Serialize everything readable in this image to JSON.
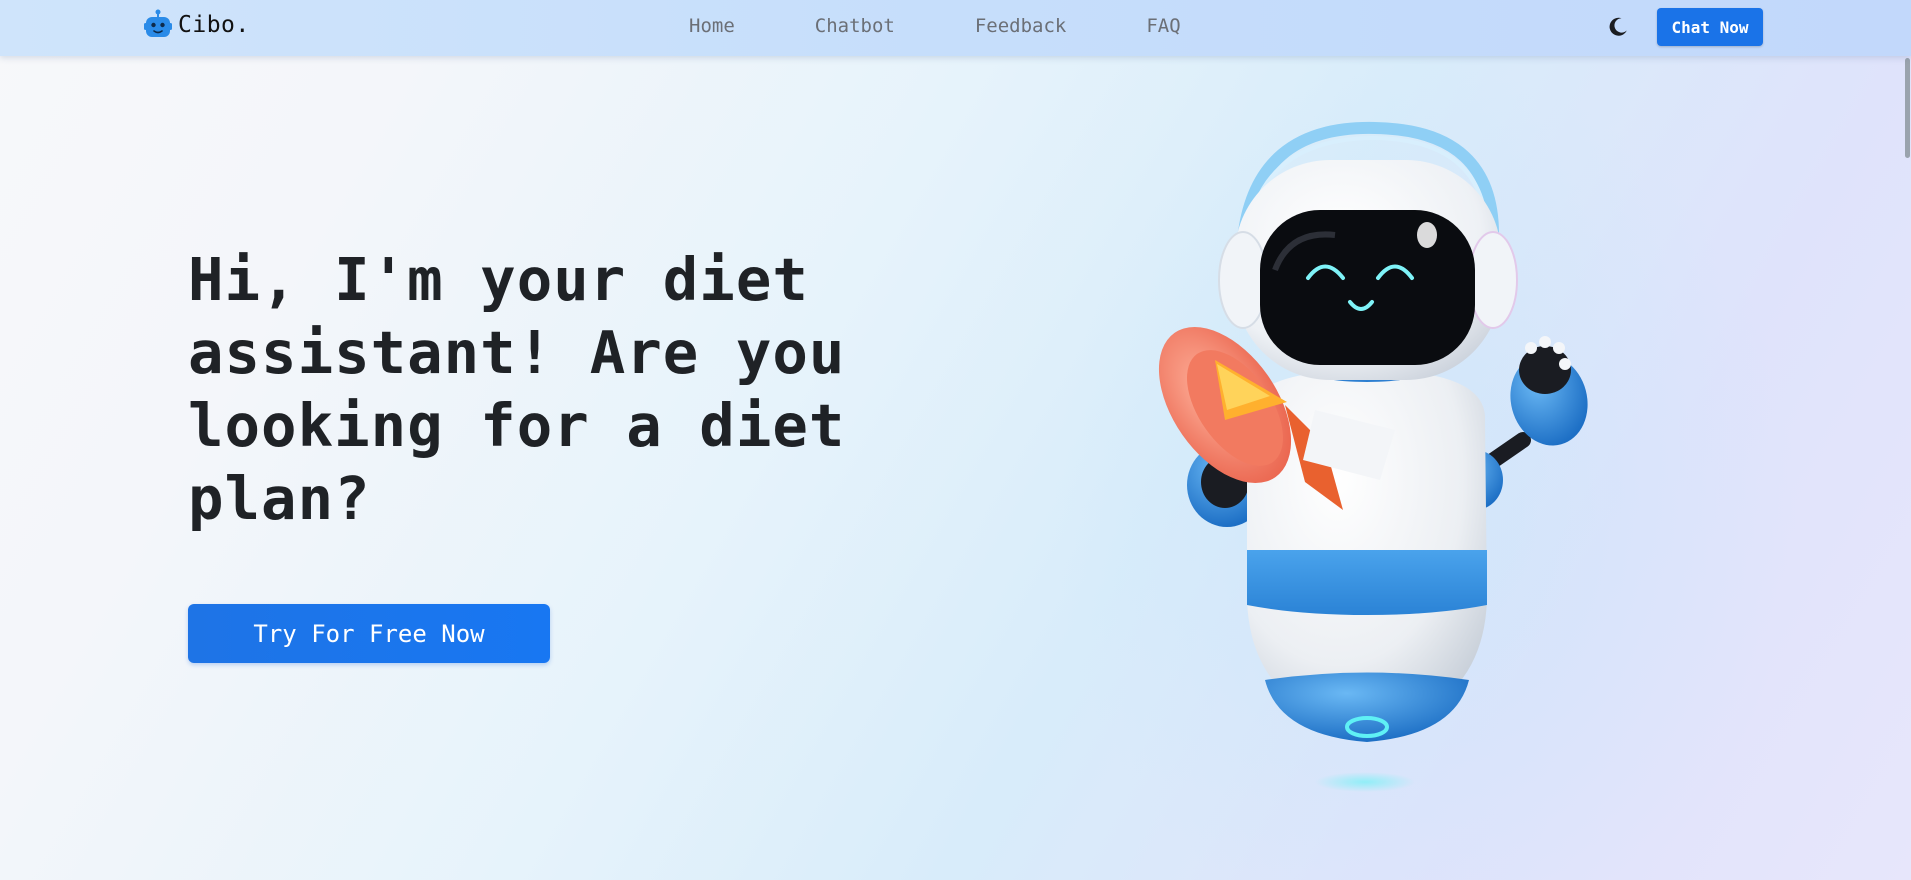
{
  "brand": {
    "name": "Cibo.",
    "logo_icon": "robot-logo-icon",
    "accent": "#1a73e8"
  },
  "nav": {
    "links": [
      {
        "label": "Home"
      },
      {
        "label": "Chatbot"
      },
      {
        "label": "Feedback"
      },
      {
        "label": "FAQ"
      }
    ],
    "theme_toggle_icon": "moon-icon",
    "chat_now_label": "Chat Now"
  },
  "hero": {
    "title": "Hi, I'm your diet assistant! Are you looking for a diet plan?",
    "cta_label": "Try For Free Now",
    "illustration": "robot-with-megaphone-illustration"
  },
  "colors": {
    "primary_button": "#1a73e8",
    "nav_background": "#c6defb",
    "text_dark": "#1f2226",
    "nav_text": "#6b6f76"
  }
}
